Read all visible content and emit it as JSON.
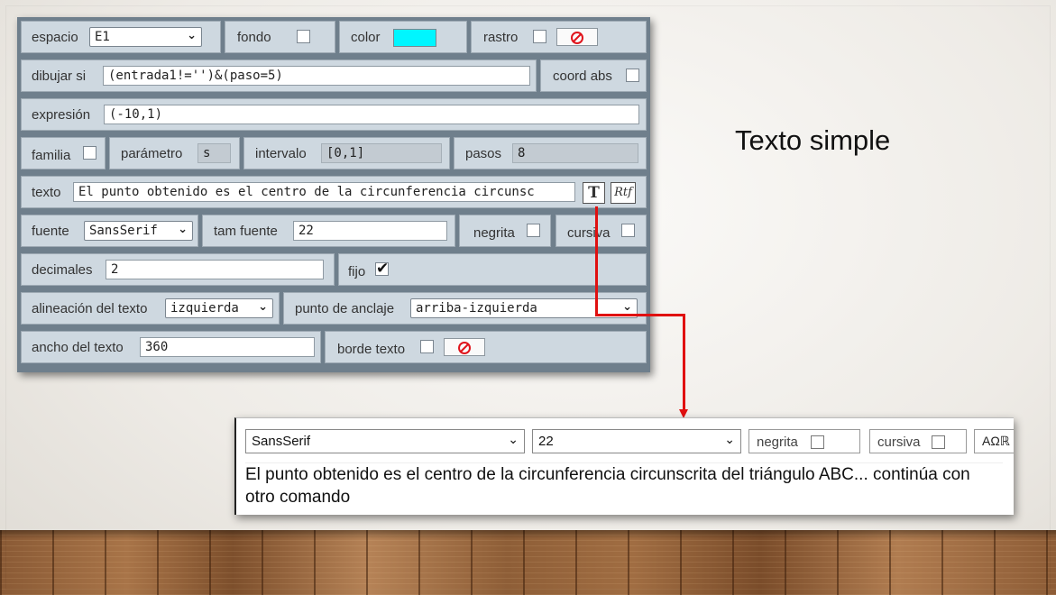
{
  "slide": {
    "title": "Texto simple"
  },
  "panel": {
    "espacio": {
      "label": "espacio",
      "value": "E1"
    },
    "fondo": {
      "label": "fondo",
      "checked": false
    },
    "color": {
      "label": "color",
      "swatch": "#00f6ff"
    },
    "rastro": {
      "label": "rastro",
      "checked": false,
      "icon": "no-entry-icon"
    },
    "dibujar_si": {
      "label": "dibujar si",
      "value": "(entrada1!='')&(paso=5)"
    },
    "coord_abs": {
      "label": "coord abs",
      "checked": false
    },
    "expresion": {
      "label": "expresión",
      "value": "(-10,1)"
    },
    "familia": {
      "label": "familia",
      "checked": false
    },
    "parametro": {
      "label": "parámetro",
      "value": "s"
    },
    "intervalo": {
      "label": "intervalo",
      "value": "[0,1]"
    },
    "pasos": {
      "label": "pasos",
      "value": "8"
    },
    "texto": {
      "label": "texto",
      "value": "El punto obtenido es el centro de la circunferencia circunsc",
      "btn_t": "T",
      "btn_rtf": "Rtf"
    },
    "fuente": {
      "label": "fuente",
      "value": "SansSerif"
    },
    "tam_fuente": {
      "label": "tam fuente",
      "value": "22"
    },
    "negrita": {
      "label": "negrita",
      "checked": false
    },
    "cursiva": {
      "label": "cursiva",
      "checked": false
    },
    "decimales": {
      "label": "decimales",
      "value": "2"
    },
    "fijo": {
      "label": "fijo",
      "checked": true
    },
    "alineacion": {
      "label": "alineación del texto",
      "value": "izquierda"
    },
    "anclaje": {
      "label": "punto de anclaje",
      "value": "arriba-izquierda"
    },
    "ancho": {
      "label": "ancho del texto",
      "value": "360"
    },
    "borde": {
      "label": "borde texto",
      "checked": false,
      "icon": "no-entry-icon"
    }
  },
  "editor": {
    "font": "SansSerif",
    "size": "22",
    "negrita": "negrita",
    "cursiva": "cursiva",
    "symbols": "AΩℝ",
    "content": "El punto obtenido es el centro de la circunferencia circunscrita del triángulo ABC... continúa con otro comando"
  },
  "colors": {
    "accent_connector": "#e01010",
    "panel_bg": "#ced8e0"
  }
}
